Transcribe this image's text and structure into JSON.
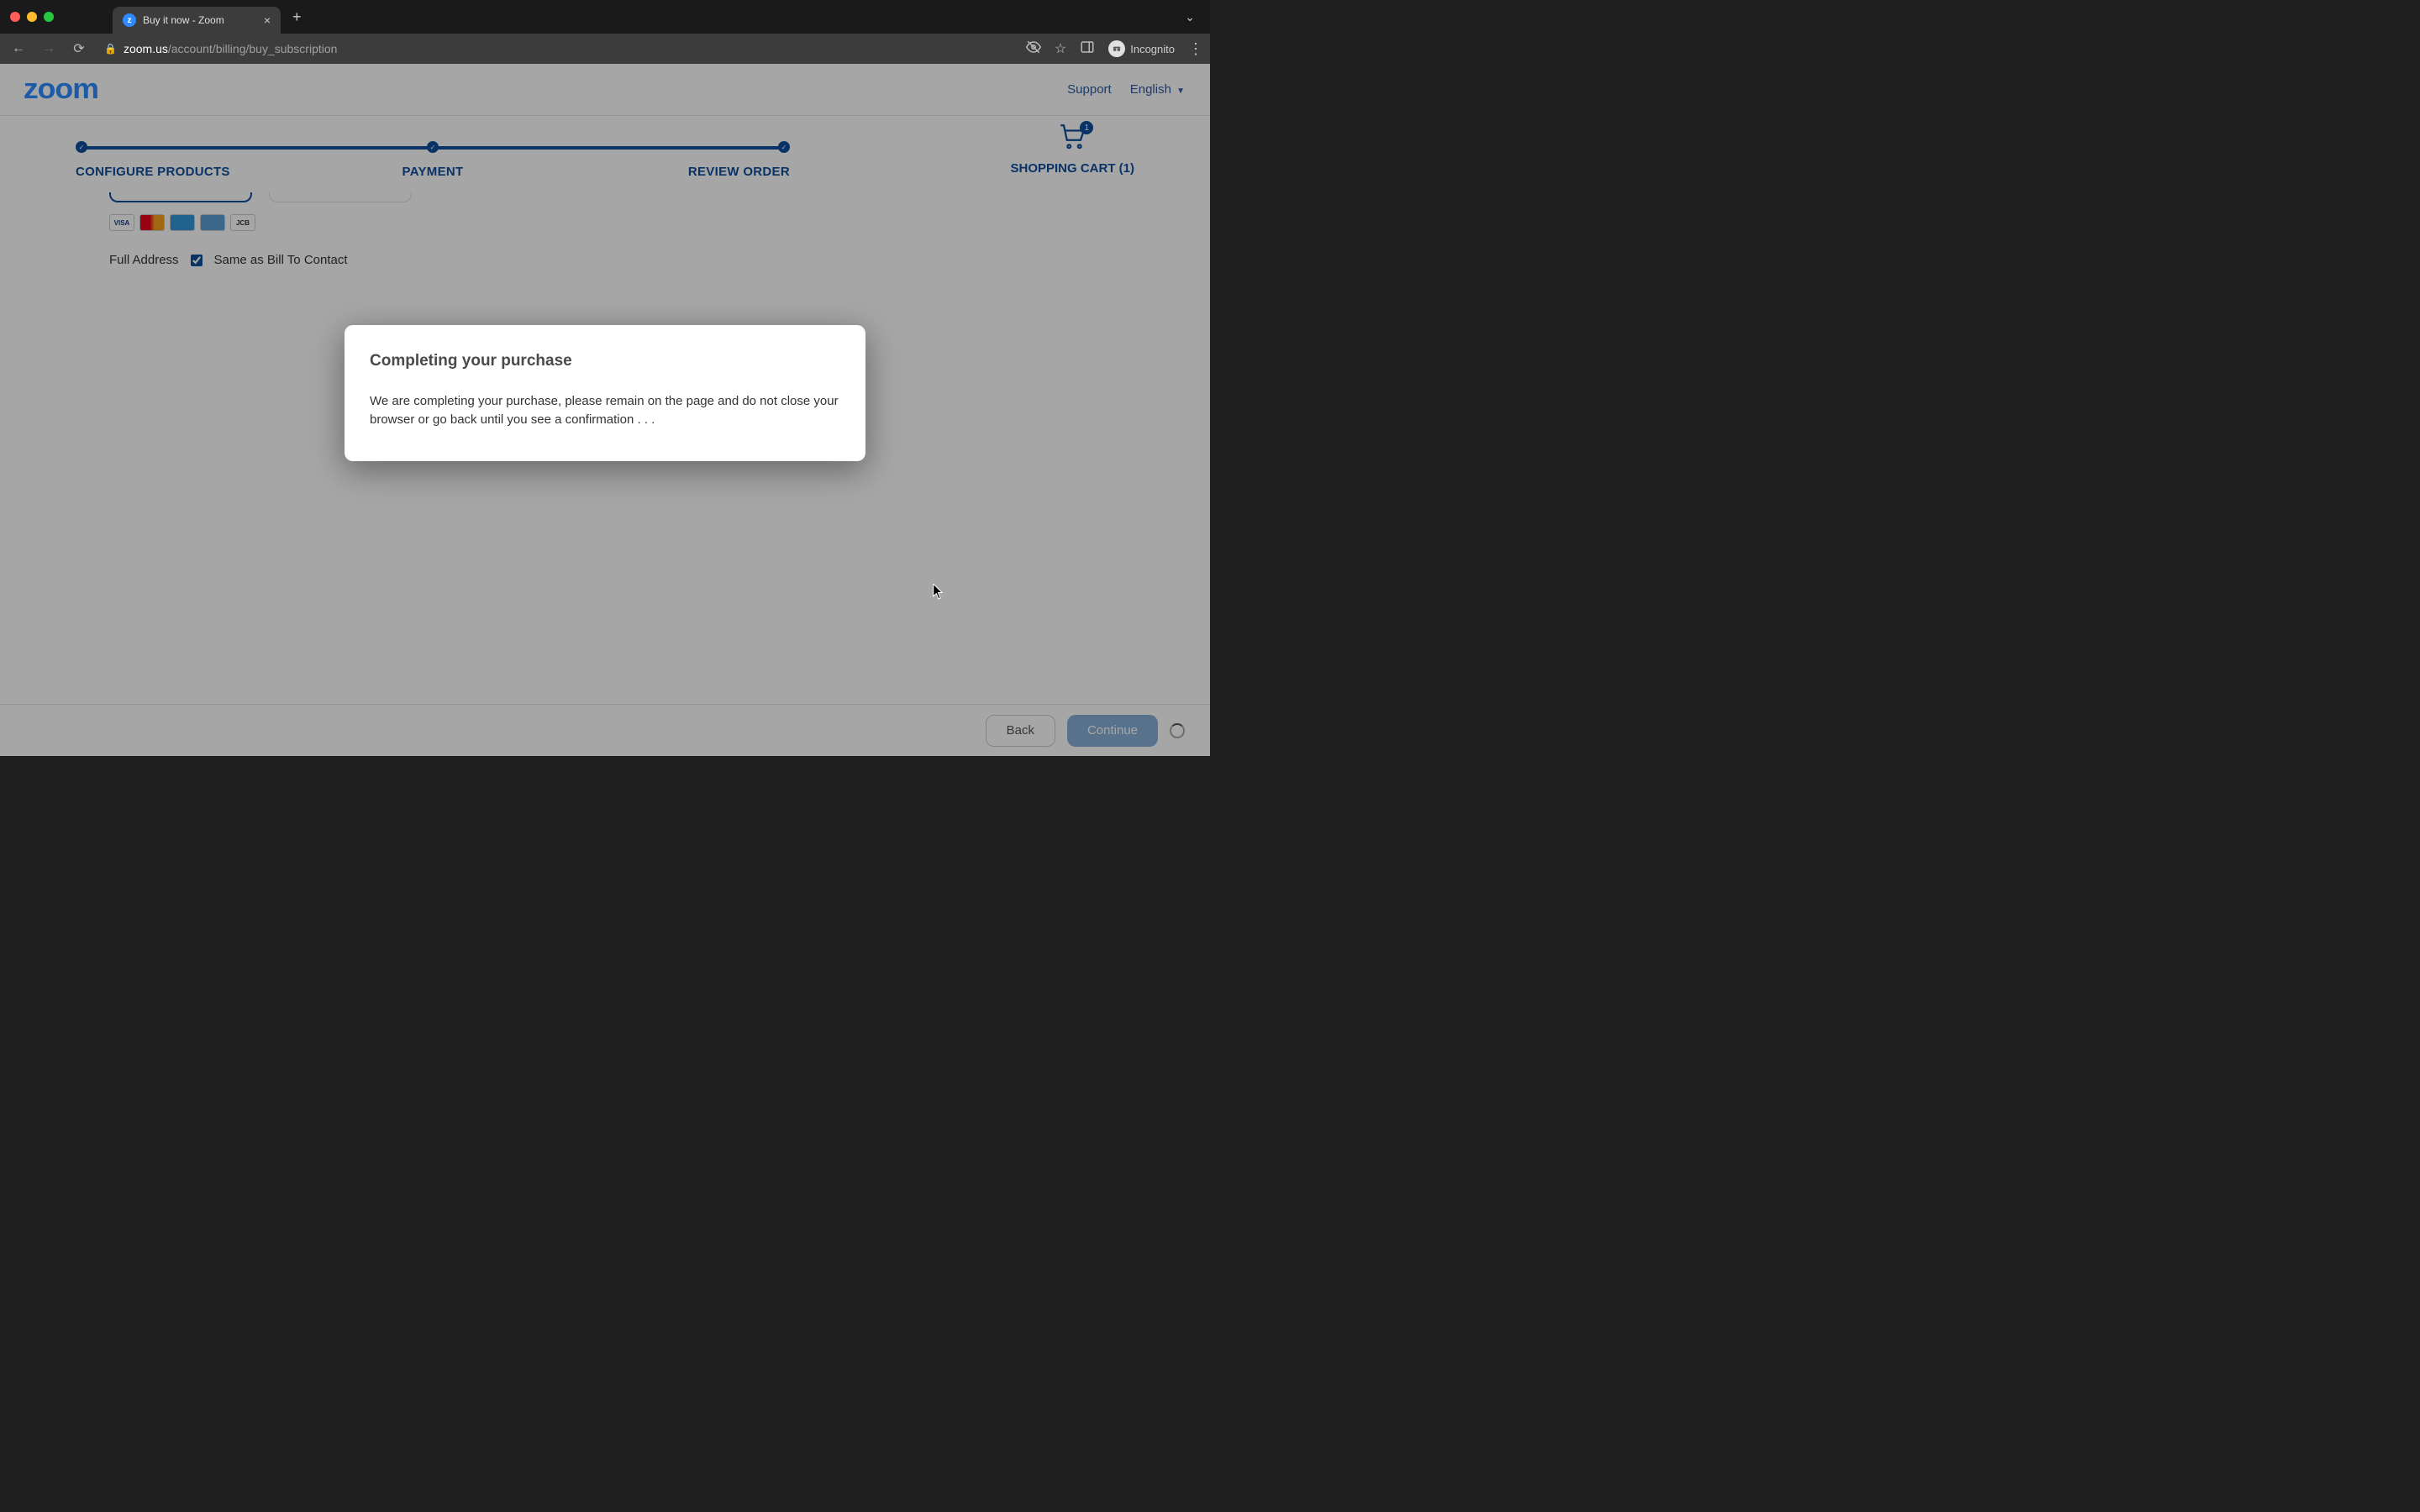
{
  "browser": {
    "tab_title": "Buy it now - Zoom",
    "url_domain": "zoom.us",
    "url_path": "/account/billing/buy_subscription",
    "incognito_label": "Incognito"
  },
  "header": {
    "logo_text": "zoom",
    "support_label": "Support",
    "language_label": "English"
  },
  "stepper": {
    "steps": [
      "CONFIGURE PRODUCTS",
      "PAYMENT",
      "REVIEW ORDER"
    ],
    "cart_label": "SHOPPING CART (1)",
    "cart_count": "1"
  },
  "payment": {
    "cards": [
      "VISA",
      "MC",
      "AMEX",
      "DISC",
      "JCB"
    ],
    "full_address_label": "Full Address",
    "same_as_label": "Same as Bill To Contact",
    "same_as_checked": true
  },
  "modal": {
    "title": "Completing your purchase",
    "body": "We are completing your purchase, please remain on the page and do not close your browser or go back until you see a confirmation . . ."
  },
  "footer": {
    "back_label": "Back",
    "continue_label": "Continue"
  }
}
